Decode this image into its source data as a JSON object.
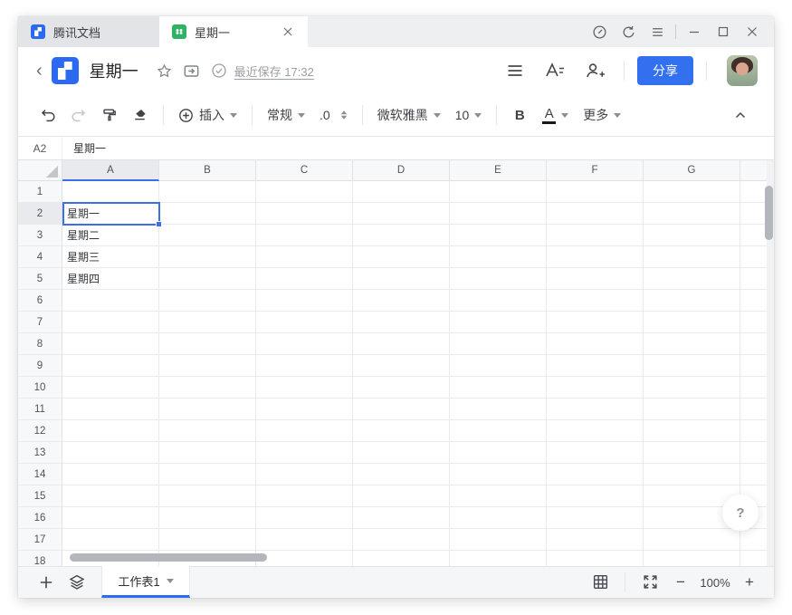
{
  "tabbar": {
    "tabs": [
      {
        "label": "腾讯文档"
      },
      {
        "label": "星期一"
      }
    ]
  },
  "titlebar": {
    "title": "星期一",
    "save_status": "最近保存 17:32",
    "share_label": "分享"
  },
  "toolbar": {
    "insert_label": "插入",
    "format_label": "常规",
    "decimal_label": ".0",
    "font_label": "微软雅黑",
    "font_size": "10",
    "bold_label": "B",
    "font_color_label": "A",
    "more_label": "更多"
  },
  "formula_bar": {
    "cell_ref": "A2",
    "value": "星期一"
  },
  "grid": {
    "columns": [
      "A",
      "B",
      "C",
      "D",
      "E",
      "F",
      "G"
    ],
    "row_labels": [
      "1",
      "2",
      "3",
      "4",
      "5",
      "6",
      "7",
      "8",
      "9",
      "10",
      "11",
      "12",
      "13",
      "14",
      "15",
      "16",
      "17",
      "18"
    ],
    "cells": {
      "A2": "星期一",
      "A3": "星期二",
      "A4": "星期三",
      "A5": "星期四"
    },
    "selection": {
      "ref": "A2",
      "col": "A",
      "row": "2"
    }
  },
  "sheetbar": {
    "sheet_name": "工作表1",
    "zoom_level": "100%",
    "zoom_out": "−",
    "zoom_in": "+"
  },
  "help_label": "?",
  "colors": {
    "accent_blue": "#3370f0",
    "selection_blue": "#3b6ee8",
    "sheet_green": "#2fb264",
    "logo_blue": "#2b6af0"
  },
  "icons": [
    "back-chevron",
    "star",
    "move-to-folder",
    "saved-check",
    "menu",
    "text-style",
    "add-collaborator",
    "undo",
    "redo",
    "format-painter",
    "eraser",
    "insert-plus",
    "decimal-stepper",
    "collapse-toolbar",
    "performance",
    "refresh",
    "minimize",
    "maximize",
    "close",
    "add-sheet",
    "all-sheets",
    "grid-view",
    "fullscreen",
    "help"
  ]
}
